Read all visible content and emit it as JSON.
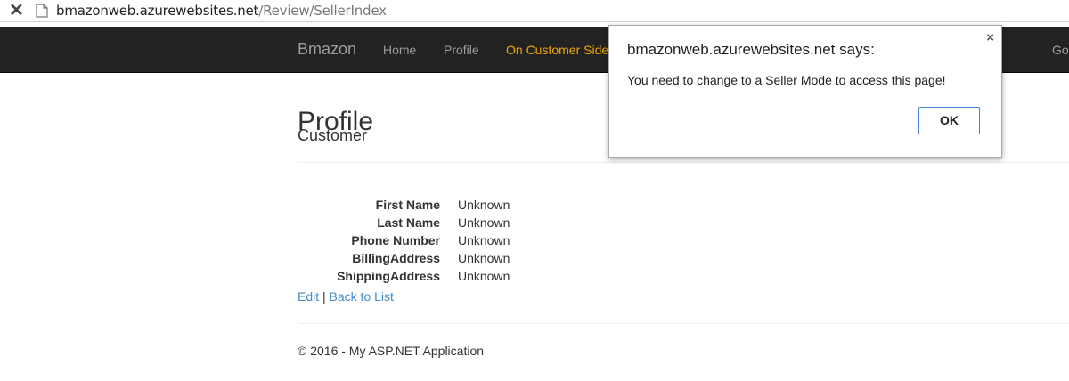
{
  "browser": {
    "url_host": "bmazonweb.azurewebsites.net",
    "url_path": "/Review/SellerIndex",
    "close_icon": "close-icon",
    "page_icon": "page-icon"
  },
  "navbar": {
    "brand": "Bmazon",
    "items": [
      {
        "label": "Home"
      },
      {
        "label": "Profile"
      },
      {
        "label": "On Customer Side"
      }
    ],
    "right_item": "Go",
    "active_color": "#f0a500"
  },
  "main": {
    "title": "Profile",
    "subtitle": "Customer",
    "fields": [
      {
        "label": "First Name",
        "value": "Unknown"
      },
      {
        "label": "Last Name",
        "value": "Unknown"
      },
      {
        "label": "Phone Number",
        "value": "Unknown"
      },
      {
        "label": "BillingAddress",
        "value": "Unknown"
      },
      {
        "label": "ShippingAddress",
        "value": "Unknown"
      }
    ],
    "edit_link": "Edit",
    "separator": "|",
    "back_link": "Back to List",
    "footer": "© 2016 - My ASP.NET Application"
  },
  "dialog": {
    "title": "bmazonweb.azurewebsites.net says:",
    "message": "You need to change to a Seller Mode to access this page!",
    "ok_label": "OK",
    "close_glyph": "×"
  }
}
